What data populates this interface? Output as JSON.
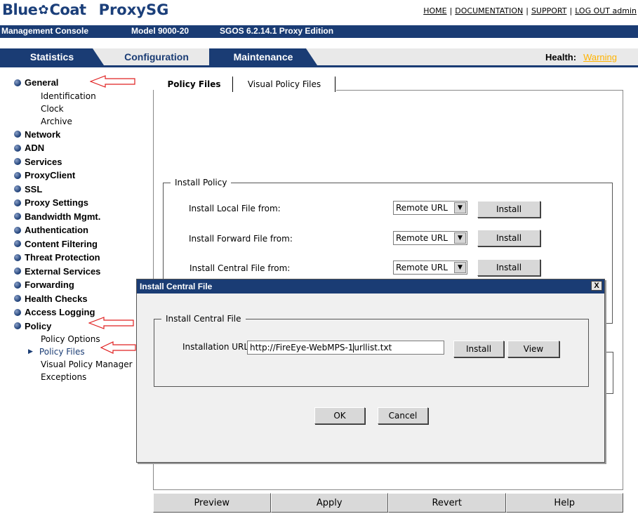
{
  "header": {
    "brand_left": "Blue",
    "brand_right": "Coat",
    "product": "ProxySG",
    "links": [
      "HOME",
      "DOCUMENTATION",
      "SUPPORT",
      "LOG OUT admin"
    ],
    "separator": "|"
  },
  "infobar": {
    "console": "Management Console",
    "model": "Model 9000-20",
    "sgos": "SGOS 6.2.14.1 Proxy Edition"
  },
  "tabs": {
    "statistics": "Statistics",
    "configuration": "Configuration",
    "maintenance": "Maintenance",
    "selected": "Configuration"
  },
  "health": {
    "label": "Health:",
    "value": "Warning",
    "value_color": "#ffb300"
  },
  "nav": {
    "general": "General",
    "general_subs": [
      "Identification",
      "Clock",
      "Archive"
    ],
    "items": [
      "Network",
      "ADN",
      "Services",
      "ProxyClient",
      "SSL",
      "Proxy Settings",
      "Bandwidth Mgmt.",
      "Authentication",
      "Content Filtering",
      "Threat Protection",
      "External Services",
      "Forwarding",
      "Health Checks",
      "Access Logging"
    ],
    "policy": "Policy",
    "policy_subs": [
      "Policy Options",
      "Policy Files",
      "Visual Policy Manager",
      "Exceptions"
    ],
    "active_sub": "Policy Files"
  },
  "subtabs": {
    "policy_files": "Policy Files",
    "visual_policy_files": "Visual Policy Files"
  },
  "install_policy": {
    "legend": "Install Policy",
    "rows": [
      {
        "label": "Install Local File from:",
        "select": "Remote URL",
        "button": "Install"
      },
      {
        "label": "Install Forward File from:",
        "select": "Remote URL",
        "button": "Install"
      },
      {
        "label": "Install Central File from:",
        "select": "Remote URL",
        "button": "Install"
      }
    ]
  },
  "dialog": {
    "title": "Install Central File",
    "close": "X",
    "legend": "Install Central File",
    "url_label": "Installation URL:",
    "url_before_caret": "http://FireEye-WebMPS-1",
    "url_after_caret": "urllist.txt",
    "install_button": "Install",
    "view_button": "View",
    "ok_button": "OK",
    "cancel_button": "Cancel"
  },
  "bottom_buttons": {
    "preview": "Preview",
    "apply": "Apply",
    "revert": "Revert",
    "help": "Help"
  },
  "colors": {
    "brand": "#1a3c74",
    "annotation_arrow": "#e02020",
    "warning": "#ffb300"
  }
}
